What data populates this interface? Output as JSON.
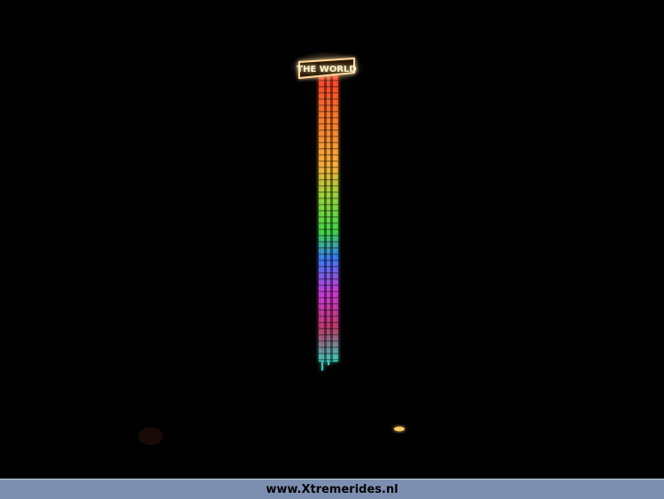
{
  "photo": {
    "sign_text": "THE WORLD",
    "colors": {
      "background": "#020101",
      "sign_glow": "#ffd79a",
      "red": "#ff3a2a",
      "orange": "#ffb13a",
      "green": "#3ed84a",
      "blue": "#3a7dff",
      "magenta": "#d03ad8",
      "teal": "#35d6c0",
      "ground_light": "#ffcc66"
    }
  },
  "footer": {
    "watermark": "www.Xtremerides.nl",
    "background": "#7d8fb0"
  }
}
